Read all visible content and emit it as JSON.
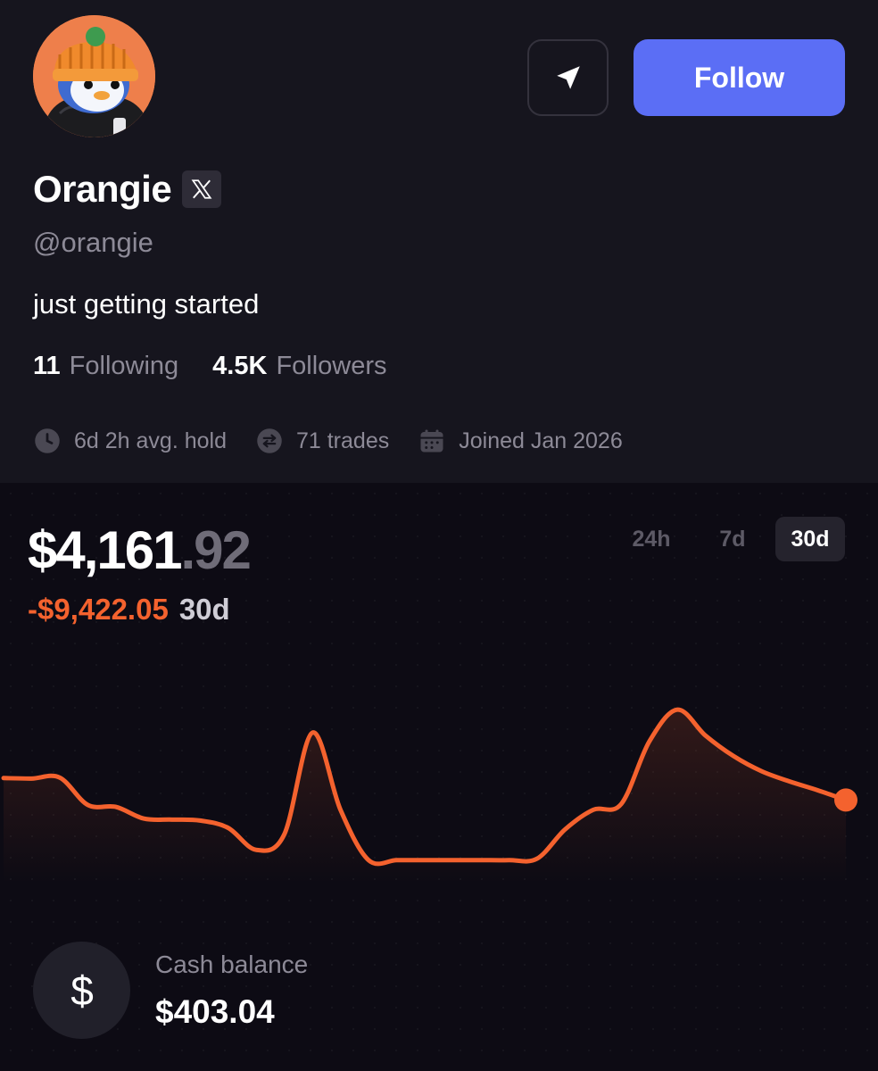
{
  "profile": {
    "name": "Orangie",
    "handle": "@orangie",
    "bio": "just getting started",
    "following_count": "11",
    "following_label": "Following",
    "followers_count": "4.5K",
    "followers_label": "Followers",
    "avg_hold": "6d 2h avg. hold",
    "trades": "71 trades",
    "joined": "Joined Jan 2026",
    "follow_label": "Follow",
    "icons": {
      "share": "send-icon",
      "social": "x-logo-icon",
      "hold": "clock-icon",
      "trades": "swap-icon",
      "joined": "calendar-icon"
    }
  },
  "portfolio": {
    "value_main": "$4,161",
    "value_cents": ".92",
    "change_amount": "-$9,422.05",
    "change_period": "30d",
    "ranges": [
      "24h",
      "7d",
      "30d"
    ],
    "selected_range": "30d"
  },
  "chart_data": {
    "type": "line",
    "title": "",
    "xlabel": "",
    "ylabel": "",
    "color": "#f4622e",
    "grid": false,
    "legend": "none",
    "x": [
      0,
      1,
      2,
      3,
      4,
      5,
      6,
      7,
      8,
      9,
      10,
      11,
      12,
      13,
      14,
      15,
      16,
      17,
      18,
      19,
      20,
      21,
      22,
      23,
      24,
      25,
      26,
      27,
      28,
      29,
      30
    ],
    "values": [
      10550,
      10540,
      10560,
      10000,
      9960,
      9720,
      9700,
      9680,
      9530,
      9080,
      9400,
      11480,
      9900,
      8870,
      8870,
      8870,
      8870,
      8870,
      8870,
      8900,
      9500,
      9900,
      10020,
      11300,
      11950,
      11420,
      11000,
      10690,
      10480,
      10300,
      10100
    ],
    "ylim": [
      8500,
      12300
    ]
  },
  "cash": {
    "label": "Cash balance",
    "value": "$403.04",
    "icon": "dollar-icon"
  },
  "colors": {
    "accent": "#5b6ef5",
    "negative": "#f4622e",
    "avatar_bg": "#ee7f4b"
  }
}
